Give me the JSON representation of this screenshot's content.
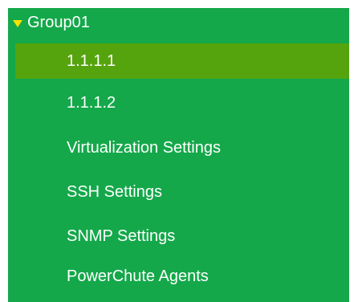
{
  "nav": {
    "group": {
      "label": "Group01",
      "expanded": true,
      "caret_icon": "triangle-down-icon",
      "caret_color": "#f4e200"
    },
    "items": [
      {
        "label": "1.1.1.1",
        "selected": true
      },
      {
        "label": "1.1.1.2",
        "selected": false
      },
      {
        "label": "Virtualization Settings",
        "selected": false
      },
      {
        "label": "SSH Settings",
        "selected": false
      },
      {
        "label": "SNMP Settings",
        "selected": false
      },
      {
        "label": "PowerChute Agents",
        "selected": false
      }
    ]
  },
  "colors": {
    "background": "#14a84a",
    "selected_background": "#55a40e",
    "text": "#ffffff"
  }
}
